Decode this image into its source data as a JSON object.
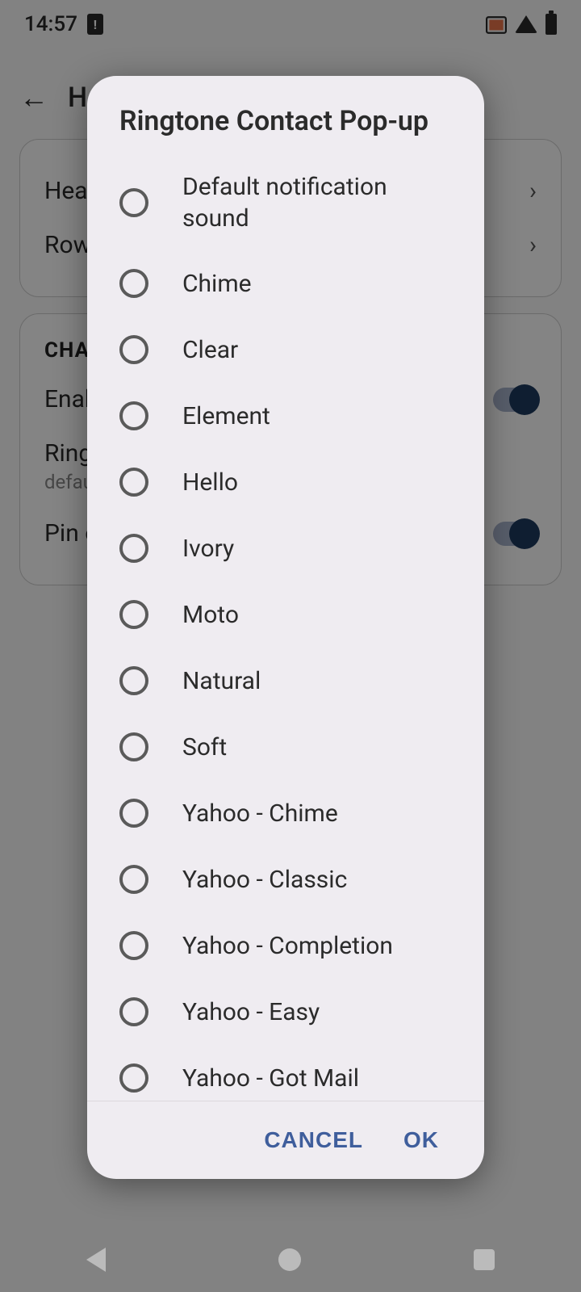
{
  "status": {
    "time": "14:57"
  },
  "bg": {
    "title": "H",
    "heads_label": "Head",
    "rows_label": "Rows",
    "section": "CHAT",
    "enable_label": "Enabl",
    "ringtone_label": "Ringto",
    "ringtone_sub": "default",
    "pin_label": "Pin ov"
  },
  "dialog": {
    "title": "Ringtone Contact Pop-up",
    "options": [
      {
        "label": "Default notification sound",
        "name": "option-default-notification"
      },
      {
        "label": "Chime",
        "name": "option-chime"
      },
      {
        "label": "Clear",
        "name": "option-clear"
      },
      {
        "label": "Element",
        "name": "option-element"
      },
      {
        "label": "Hello",
        "name": "option-hello"
      },
      {
        "label": "Ivory",
        "name": "option-ivory"
      },
      {
        "label": "Moto",
        "name": "option-moto"
      },
      {
        "label": "Natural",
        "name": "option-natural"
      },
      {
        "label": "Soft",
        "name": "option-soft"
      },
      {
        "label": "Yahoo - Chime",
        "name": "option-yahoo-chime"
      },
      {
        "label": "Yahoo - Classic",
        "name": "option-yahoo-classic"
      },
      {
        "label": "Yahoo - Completion",
        "name": "option-yahoo-completion"
      },
      {
        "label": "Yahoo - Easy",
        "name": "option-yahoo-easy"
      },
      {
        "label": "Yahoo - Got Mail",
        "name": "option-yahoo-got-mail"
      }
    ],
    "cancel": "CANCEL",
    "ok": "OK"
  }
}
